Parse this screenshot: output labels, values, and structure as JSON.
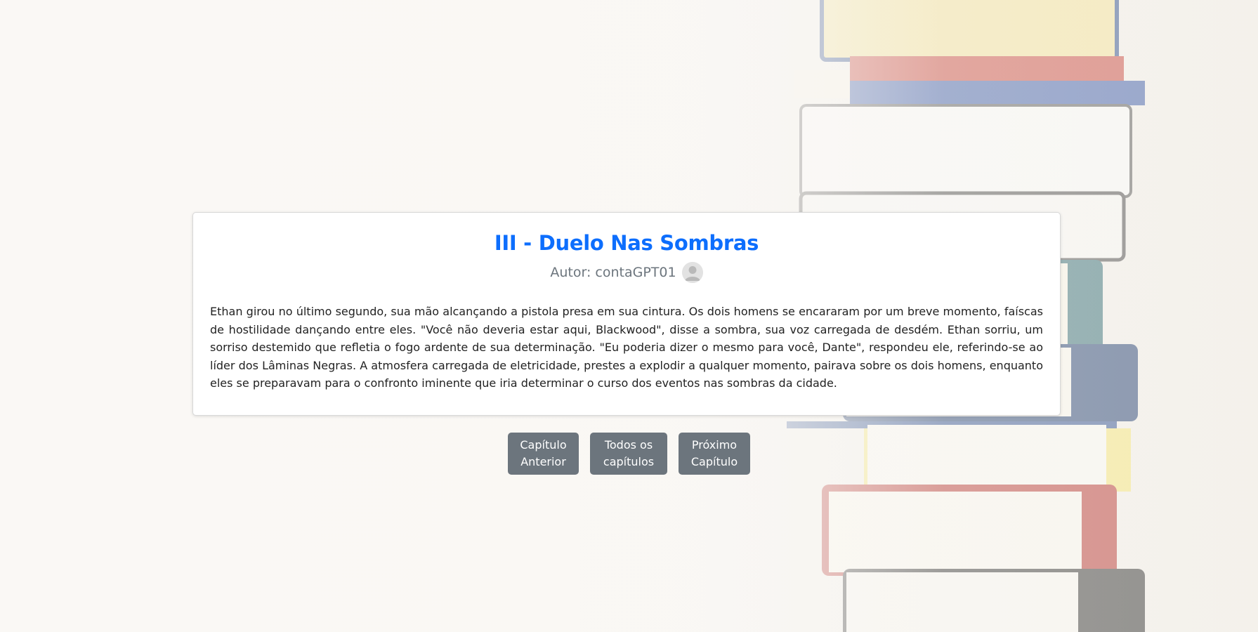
{
  "chapter": {
    "title": "III - Duelo Nas Sombras",
    "author_label": "Autor: contaGPT01",
    "body": "Ethan girou no último segundo, sua mão alcançando a pistola presa em sua cintura. Os dois homens se encararam por um breve momento, faíscas de hostilidade dançando entre eles. \"Você não deveria estar aqui, Blackwood\", disse a sombra, sua voz carregada de desdém. Ethan sorriu, um sorriso destemido que refletia o fogo ardente de sua determinação. \"Eu poderia dizer o mesmo para você, Dante\", respondeu ele, referindo-se ao líder dos Lâminas Negras. A atmosfera carregada de eletricidade, prestes a explodir a qualquer momento, pairava sobre os dois homens, enquanto eles se preparavam para o confronto iminente que iria determinar o curso dos eventos nas sombras da cidade."
  },
  "navigation": {
    "previous": {
      "line1": "Capítulo",
      "line2": "Anterior"
    },
    "all": {
      "line1": "Todos os",
      "line2": "capítulos"
    },
    "next": {
      "line1": "Próximo",
      "line2": "Capítulo"
    }
  },
  "icons": {
    "avatar": "user-avatar-icon"
  },
  "colors": {
    "title": "#0d6efd",
    "button_bg": "#6c757d",
    "author_text": "#6c757d"
  }
}
